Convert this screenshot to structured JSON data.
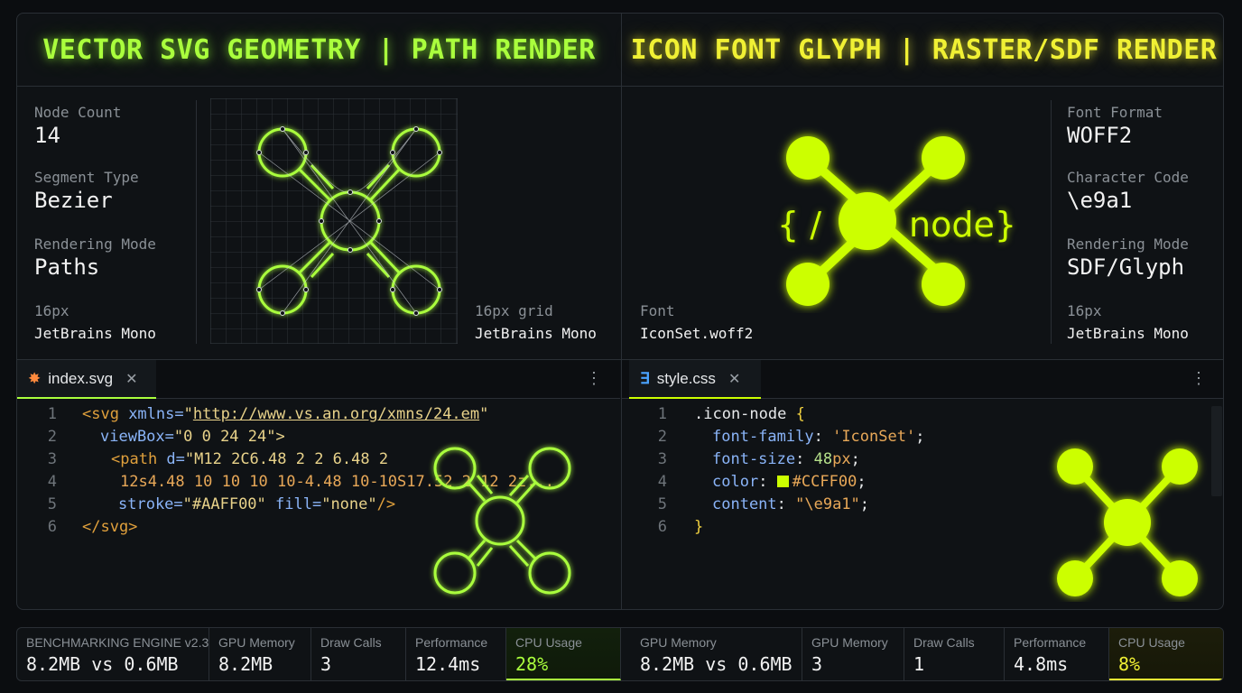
{
  "left_panel": {
    "header": "VECTOR SVG GEOMETRY | PATH RENDER",
    "stats": [
      {
        "label": "Node Count",
        "value": "14"
      },
      {
        "label": "Segment Type",
        "value": "Bezier"
      },
      {
        "label": "Rendering Mode",
        "value": "Paths"
      }
    ],
    "font_size_label": "16px",
    "font_name": "JetBrains Mono",
    "grid_label": "16px grid",
    "grid_font": "JetBrains Mono"
  },
  "right_panel": {
    "header": "ICON FONT GLYPH | RASTER/SDF RENDER",
    "glyph_left_text": "{ /",
    "glyph_right_text": "node}",
    "stats": [
      {
        "label": "Font Format",
        "value": "WOFF2"
      },
      {
        "label": "Character Code",
        "value": "\\e9a1"
      },
      {
        "label": "Rendering Mode",
        "value": "SDF/Glyph"
      }
    ],
    "font_label": "Font",
    "font_file": "IconSet.woff2",
    "size_label": "16px",
    "size_font": "JetBrains Mono"
  },
  "editor_left": {
    "tab_label": "index.svg",
    "line_numbers": [
      "1",
      "2",
      "3",
      "4",
      "5",
      "6"
    ]
  },
  "editor_right": {
    "tab_label": "style.css",
    "line_numbers": [
      "1",
      "2",
      "3",
      "4",
      "5",
      "6"
    ]
  },
  "code_tokens": {
    "l1_open": "<svg ",
    "l1_attr": "xmlns=",
    "l1_q1": "\"",
    "l1_url": "http://www.vs.an.org/xmns/24.em",
    "l1_q2": "\"",
    "l2_attr": "viewBox=",
    "l2_val": "\"0 0 24 24\">",
    "l3_tag": "<path ",
    "l3_attr": "d=",
    "l3_val": "\"M12 2C6.48 2 2 6.48 2",
    "l4_val": "12s4.48 10 10 10 10-4.48 10-10S17.52 2 12 2z...",
    "l5_attr1": "stroke=",
    "l5_val1": "\"#AAFF00\"",
    "l5_attr2": " fill=",
    "l5_val2": "\"none\"",
    "l5_close": "/>",
    "l6": "</svg>",
    "c1_sel": ".icon-node",
    "c1_brace": " {",
    "c2_prop": "font-family",
    "c2_val": "'IconSet'",
    "c3_prop": "font-size",
    "c3_num": "48",
    "c3_unit": "px",
    "c4_prop": "color",
    "c4_val": "#CCFF00",
    "c5_prop": "content",
    "c5_val": "\"\\e9a1\"",
    "c6": "}",
    "colon": ": ",
    "semi": ";"
  },
  "benchmark": [
    {
      "title": "BENCHMARKING ENGINE v2.3",
      "value": "8.2MB vs 0.6MB"
    },
    {
      "title": "GPU Memory",
      "value": "8.2MB"
    },
    {
      "title": "Draw Calls",
      "value": "3"
    },
    {
      "title": "Performance",
      "value": "12.4ms"
    },
    {
      "title": "CPU Usage",
      "value": "28%"
    },
    {
      "title": "GPU Memory",
      "value": "8.2MB vs 0.6MB"
    },
    {
      "title": "GPU Memory",
      "value": "3"
    },
    {
      "title": "Draw Calls",
      "value": "1"
    },
    {
      "title": "Performance",
      "value": "4.8ms"
    },
    {
      "title": "CPU Usage",
      "value": "8%"
    }
  ],
  "colors": {
    "green": "#aaff3d",
    "yellow": "#ccff00",
    "header_yellow": "#f0f034"
  },
  "icons": [
    "svg-file-icon",
    "css-file-icon",
    "close-icon",
    "more-options-icon",
    "node-network-icon"
  ]
}
